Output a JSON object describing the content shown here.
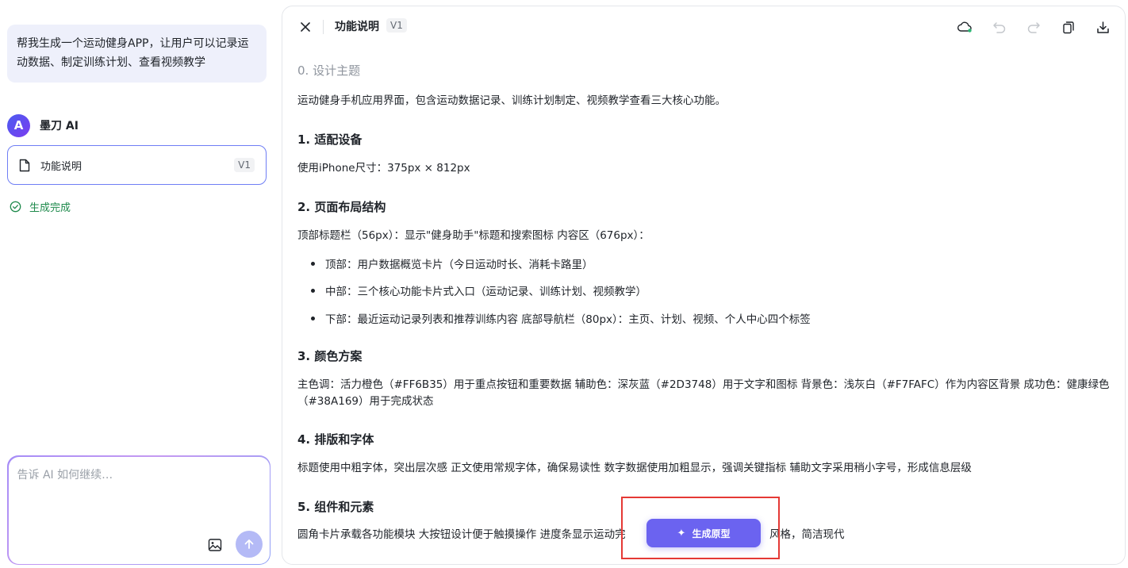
{
  "left": {
    "user_message": "帮我生成一个运动健身APP，让用户可以记录运动数据、制定训练计划、查看视频教学",
    "ai_name": "墨刀 AI",
    "ai_logo_letter": "A",
    "doc_card": {
      "title": "功能说明",
      "version": "V1"
    },
    "status": "生成完成",
    "composer": {
      "placeholder": "告诉 AI 如何继续…"
    }
  },
  "topbar": {
    "title": "功能说明",
    "version": "V1",
    "icons": [
      "close-icon",
      "cloud-saved-icon",
      "undo-icon",
      "redo-icon",
      "copy-icon",
      "download-icon"
    ]
  },
  "doc": {
    "s0_heading": "0. 设计主题",
    "s0_text": "运动健身手机应用界面，包含运动数据记录、训练计划制定、视频教学查看三大核心功能。",
    "s1_heading": "1. 适配设备",
    "s1_text": "使用iPhone尺寸：375px × 812px",
    "s2_heading": "2. 页面布局结构",
    "s2_text": "顶部标题栏（56px）：显示\"健身助手\"标题和搜索图标 内容区（676px）：",
    "s2_items": [
      "顶部：用户数据概览卡片（今日运动时长、消耗卡路里）",
      "中部：三个核心功能卡片式入口（运动记录、训练计划、视频教学）",
      "下部：最近运动记录列表和推荐训练内容 底部导航栏（80px）：主页、计划、视频、个人中心四个标签"
    ],
    "s3_heading": "3. 颜色方案",
    "s3_text": "主色调：活力橙色（#FF6B35）用于重点按钮和重要数据 辅助色：深灰蓝（#2D3748）用于文字和图标 背景色：浅灰白（#F7FAFC）作为内容区背景 成功色：健康绿色（#38A169）用于完成状态",
    "s4_heading": "4. 排版和字体",
    "s4_text": "标题使用中粗字体，突出层次感 正文使用常规字体，确保易读性 数字数据使用加粗显示，强调关键指标 辅助文字采用稍小字号，形成信息层级",
    "s5_heading": "5. 组件和元素",
    "s5_text_a": "圆角卡片承载各功能模块 大按钮设计便于触摸操作 进度条显示运动完",
    "s5_text_b": "风格，简洁现代"
  },
  "generate_button": {
    "label": "生成原型",
    "icon": "sparkle-icon"
  },
  "colors": {
    "accent": "#6B63F0",
    "success": "#1F8A4C",
    "highlight_box": "#E53935",
    "user_bubble": "#EEF0FB"
  }
}
